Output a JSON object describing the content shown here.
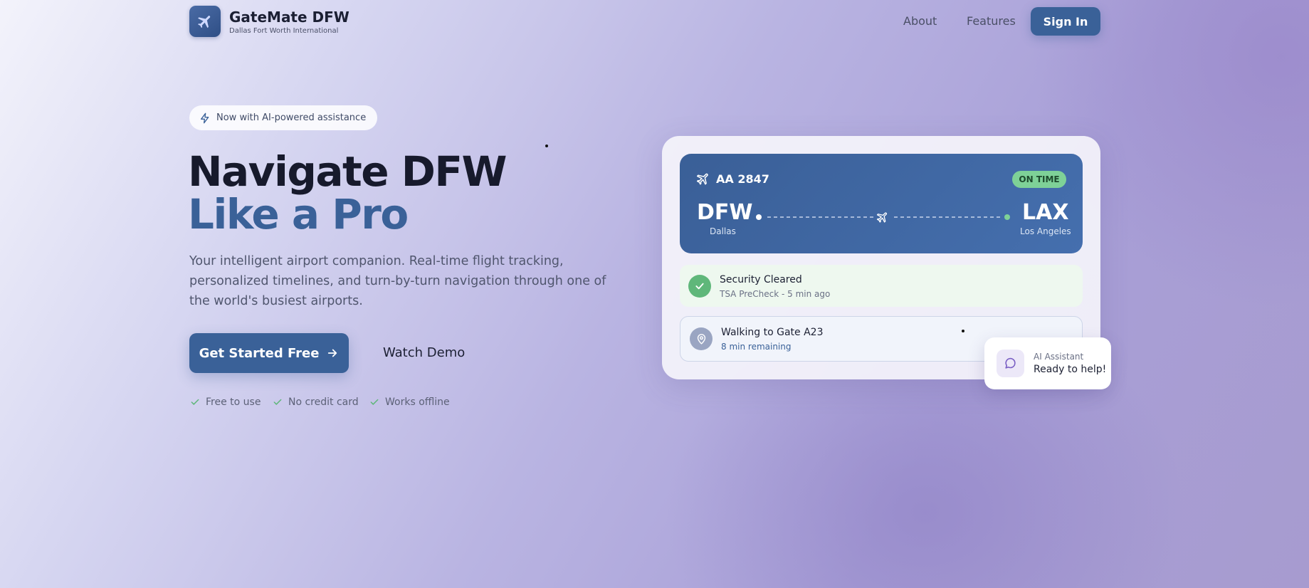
{
  "nav": {
    "brand_name": "GateMate DFW",
    "brand_sub": "Dallas Fort Worth International",
    "links": [
      "About",
      "Features"
    ],
    "signin": "Sign In"
  },
  "hero": {
    "badge": "Now with AI-powered assistance",
    "title_line1": "Navigate DFW",
    "title_line2": "Like a Pro",
    "lede": "Your intelligent airport companion. Real-time flight tracking, personalized timelines, and turn-by-turn navigation through one of the world's busiest airports.",
    "cta_primary": "Get Started Free",
    "cta_secondary": "Watch Demo",
    "perks": [
      "Free to use",
      "No credit card",
      "Works offline"
    ]
  },
  "flight_card": {
    "flight_number": "AA 2847",
    "status": "ON TIME",
    "origin_code": "DFW",
    "origin_city": "Dallas",
    "dest_code": "LAX",
    "dest_city": "Los Angeles",
    "security": {
      "title": "Security Cleared",
      "sub": "TSA PreCheck - 5 min ago"
    },
    "walking": {
      "title": "Walking to Gate A23",
      "sub": "8 min remaining"
    }
  },
  "assistant": {
    "label": "AI Assistant",
    "message": "Ready to help!"
  },
  "colors": {
    "primary": "#3a6198",
    "status_green": "#7ed197",
    "check_green": "#5fb77a",
    "accent_purple": "#7a5fc4"
  },
  "icons": {
    "logo": "airplane-icon",
    "badge": "lightning-icon",
    "cta": "arrow-right-icon",
    "perk": "check-icon",
    "security": "check-circle-icon",
    "walking": "map-pin-icon",
    "assistant": "chat-bubble-icon"
  }
}
